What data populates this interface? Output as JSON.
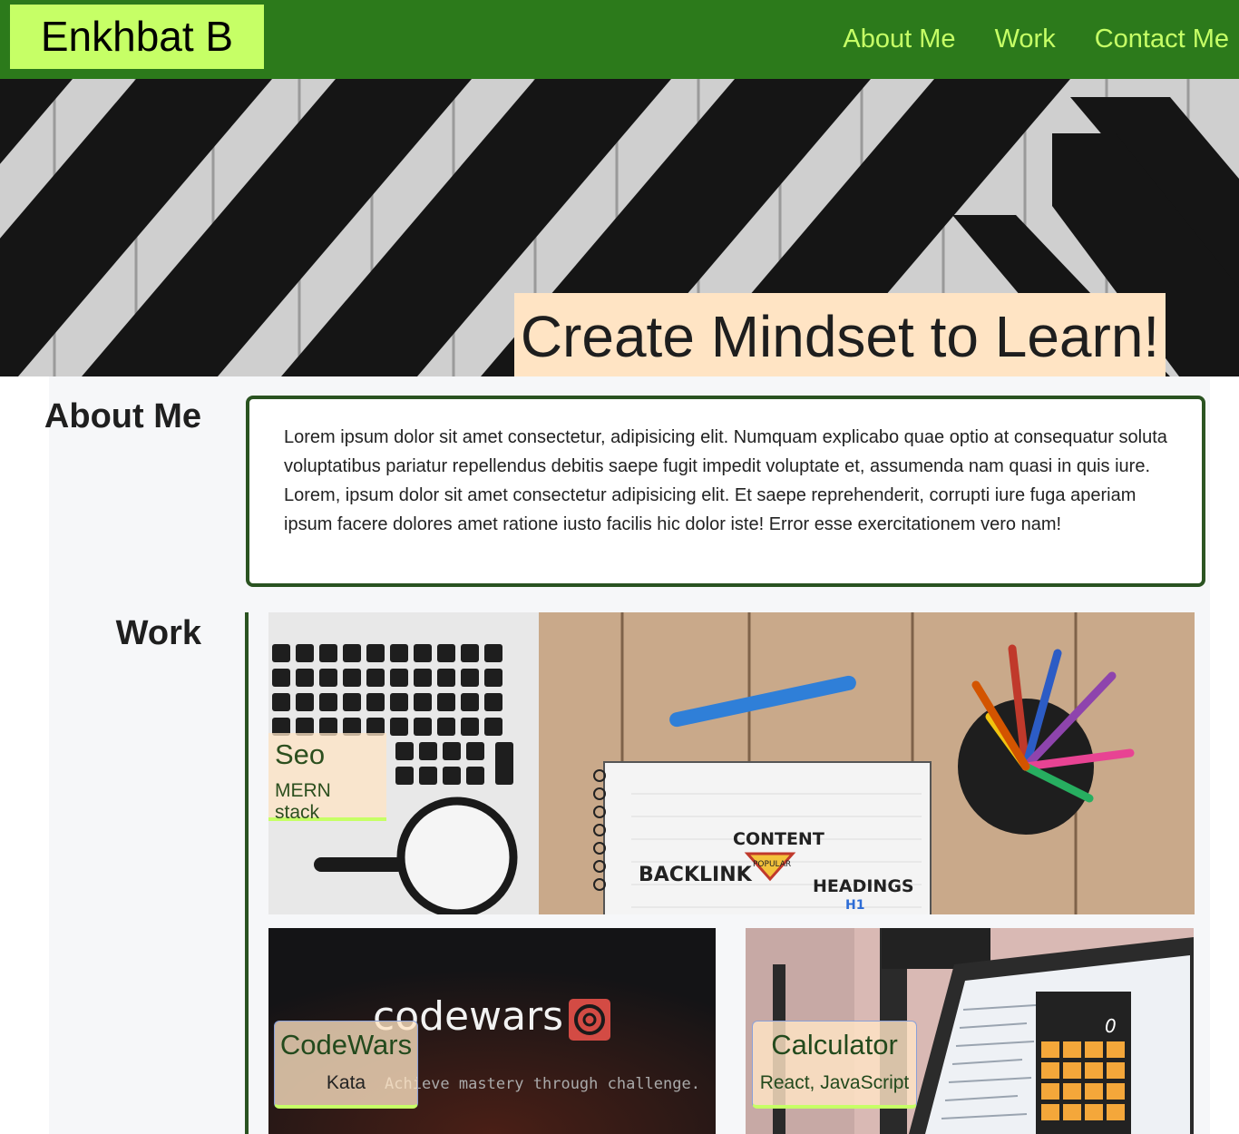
{
  "header": {
    "brand": "Enkhbat B",
    "nav": [
      {
        "label": "About Me"
      },
      {
        "label": "Work"
      },
      {
        "label": "Contact Me"
      }
    ]
  },
  "hero": {
    "title": "Create Mindset to Learn!"
  },
  "about": {
    "heading": "About Me",
    "text": "Lorem ipsum dolor sit amet consectetur, adipisicing elit. Numquam explicabo quae optio at consequatur soluta voluptatibus pariatur repellendus debitis saepe fugit impedit voluptate et, assumenda nam quasi in quis iure. Lorem, ipsum dolor sit amet consectetur adipisicing elit. Et saepe reprehenderit, corrupti iure fuga aperiam ipsum facere dolores amet ratione iusto facilis hic dolor iste! Error esse exercitationem vero nam!"
  },
  "work": {
    "heading": "Work",
    "projects": [
      {
        "title": "Seo",
        "subtitle": "MERN stack",
        "image_words": [
          "CONTENT",
          "POPULAR",
          "BACKLINK",
          "HEADINGS",
          "H1"
        ]
      },
      {
        "title": "CodeWars",
        "subtitle": "Kata",
        "image_logo": "codewars",
        "image_tagline": "Achieve mastery through challenge."
      },
      {
        "title": "Calculator",
        "subtitle": "React, JavaScript",
        "image_display": "0"
      }
    ]
  },
  "colors": {
    "header_bg": "#2c7a1b",
    "accent_lime": "#c6ff66",
    "label_bg": "#ffe4c4",
    "section_border": "#2a5321"
  }
}
